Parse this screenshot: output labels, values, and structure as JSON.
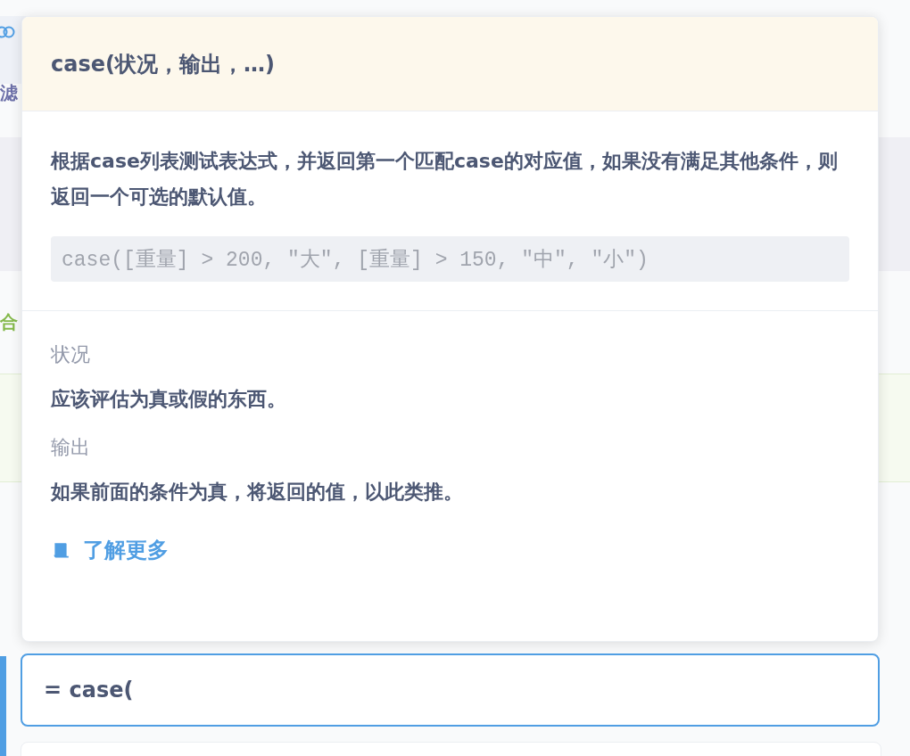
{
  "background": {
    "labels": [
      {
        "text": "滤",
        "color": "#6b6fa8"
      },
      {
        "text": "合",
        "color": "#84b84a"
      }
    ]
  },
  "popup": {
    "signature": "case(状况，输出，…)",
    "description": "根据case列表测试表达式，并返回第一个匹配case的对应值，如果没有满足其他条件，则返回一个可选的默认值。",
    "example": "case([重量] > 200, \"大\", [重量] > 150, \"中\", \"小\")",
    "arguments": [
      {
        "name": "状况",
        "description": "应该评估为真或假的东西。"
      },
      {
        "name": "输出",
        "description": "如果前面的条件为真，将返回的值，以此类推。"
      }
    ],
    "learn_more": "了解更多"
  },
  "editor": {
    "value": "= case("
  }
}
